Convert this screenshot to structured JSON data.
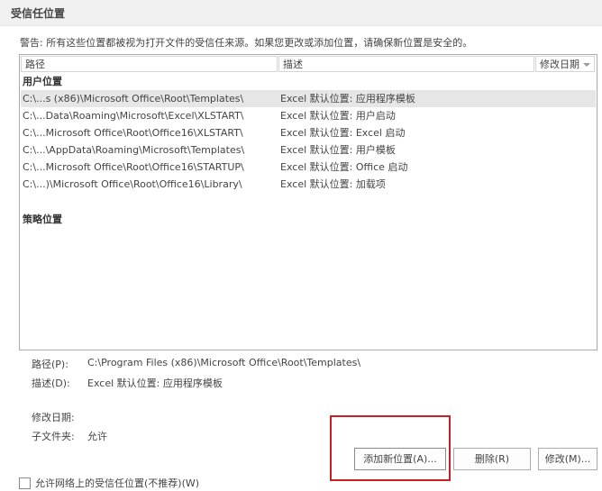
{
  "section": {
    "title": "受信任位置"
  },
  "warning": "警告: 所有这些位置都被视为打开文件的受信任来源。如果您更改或添加位置，请确保新位置是安全的。",
  "table": {
    "columns": [
      "路径",
      "描述",
      "修改日期"
    ],
    "groups": [
      {
        "label": "用户位置",
        "rows": [
          {
            "path": "C:\\...s (x86)\\Microsoft Office\\Root\\Templates\\",
            "desc": "Excel 默认位置: 应用程序模板",
            "selected": true
          },
          {
            "path": "C:\\...Data\\Roaming\\Microsoft\\Excel\\XLSTART\\",
            "desc": "Excel 默认位置: 用户启动",
            "selected": false
          },
          {
            "path": "C:\\...Microsoft Office\\Root\\Office16\\XLSTART\\",
            "desc": "Excel 默认位置: Excel 启动",
            "selected": false
          },
          {
            "path": "C:\\...\\AppData\\Roaming\\Microsoft\\Templates\\",
            "desc": "Excel 默认位置: 用户模板",
            "selected": false
          },
          {
            "path": "C:\\...Microsoft Office\\Root\\Office16\\STARTUP\\",
            "desc": "Excel 默认位置: Office 启动",
            "selected": false
          },
          {
            "path": "C:\\...)\\Microsoft Office\\Root\\Office16\\Library\\",
            "desc": "Excel 默认位置: 加载项",
            "selected": false
          }
        ]
      },
      {
        "label": "策略位置",
        "rows": []
      }
    ]
  },
  "details": {
    "path_label": "路径(P):",
    "path_value": "C:\\Program Files (x86)\\Microsoft Office\\Root\\Templates\\",
    "desc_label": "描述(D):",
    "desc_value": "Excel 默认位置: 应用程序模板",
    "date_label": "修改日期:",
    "date_value": "",
    "subfolder_label": "子文件夹:",
    "subfolder_value": "允许"
  },
  "buttons": {
    "add": "添加新位置(A)...",
    "remove": "删除(R)",
    "modify": "修改(M)..."
  },
  "network_checkbox": {
    "label": "允许网络上的受信任位置(不推荐)(W)",
    "checked": false
  },
  "colors": {
    "header_bg": "#f0f0f0",
    "selected_row": "#e6e6e6",
    "highlight": "#c8201f"
  }
}
